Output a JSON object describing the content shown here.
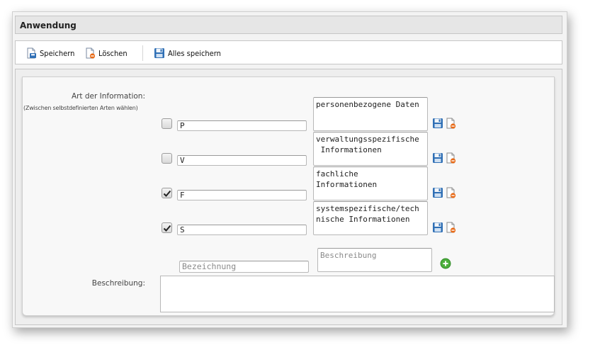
{
  "panel": {
    "title": "Anwendung"
  },
  "toolbar": {
    "save_label": "Speichern",
    "delete_label": "Löschen",
    "save_all_label": "Alles speichern"
  },
  "form": {
    "type_label": "Art der Information:",
    "type_hint": "(Zwischen selbstdefinierten Arten wählen)",
    "rows": [
      {
        "checked": false,
        "code": "P",
        "description": "personenbezogene Daten"
      },
      {
        "checked": false,
        "code": "V",
        "description": "verwaltungsspezifische\n Informationen"
      },
      {
        "checked": true,
        "code": "F",
        "description": "fachliche\nInformationen"
      },
      {
        "checked": true,
        "code": "S",
        "description": "systemspezifische/tech\nnische Informationen"
      }
    ],
    "new_row": {
      "name_placeholder": "Bezeichnung",
      "description_placeholder": "Beschreibung"
    },
    "description_label": "Beschreibung:",
    "description_value": ""
  },
  "icons": {
    "save": "floppy-disk-icon",
    "delete": "delete-document-icon",
    "add": "add-circle-icon",
    "check": "checkmark-icon"
  },
  "colors": {
    "add_green": "#4caf3c",
    "delete_orange": "#e86a17",
    "save_blue": "#2f6fb5"
  }
}
